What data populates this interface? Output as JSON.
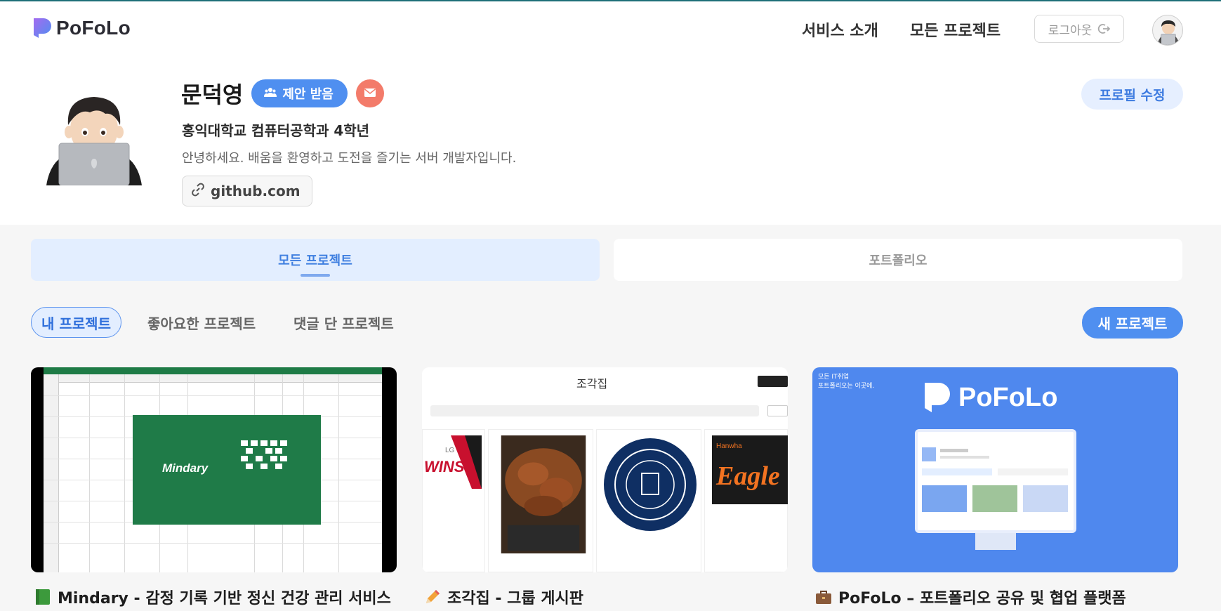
{
  "header": {
    "logo_text": "PoFoLo",
    "nav": [
      "서비스 소개",
      "모든 프로젝트"
    ],
    "logout_label": "로그아웃"
  },
  "profile": {
    "name": "문덕영",
    "offer_badge": "제안 받음",
    "school": "홍익대학교 컴퓨터공학과 4학년",
    "intro": "안녕하세요. 배움을 환영하고 도전을 즐기는 서버 개발자입니다.",
    "link": "github.com",
    "edit_label": "프로필 수정"
  },
  "main_tabs": [
    {
      "label": "모든 프로젝트",
      "active": true
    },
    {
      "label": "포트폴리오",
      "active": false
    }
  ],
  "sub_tabs": [
    {
      "label": "내 프로젝트",
      "active": true
    },
    {
      "label": "좋아요한 프로젝트",
      "active": false
    },
    {
      "label": "댓글 단 프로젝트",
      "active": false
    }
  ],
  "new_project_label": "새 프로젝트",
  "projects": [
    {
      "emoji": "green-book-icon",
      "title": "Mindary - 감정 기록 기반 정신 건강 관리 서비스",
      "thumb_text": "Mindary"
    },
    {
      "emoji": "pencil-icon",
      "title": "조각집 - 그룹 게시판",
      "thumb_text": "조각집"
    },
    {
      "emoji": "briefcase-icon",
      "title": "PoFoLo – 포트폴리오 공유 및 협업 플랫폼",
      "thumb_text": "PoFoLo",
      "thumb_caption": "모든 IT취업\n포트폴리오는 이곳에."
    }
  ],
  "colors": {
    "accent": "#4f8ff0",
    "accent_light": "#e3eeff",
    "mail": "#f37b6a",
    "mindary_green": "#1f7b48",
    "pofolo_blue": "#4f88ee"
  }
}
